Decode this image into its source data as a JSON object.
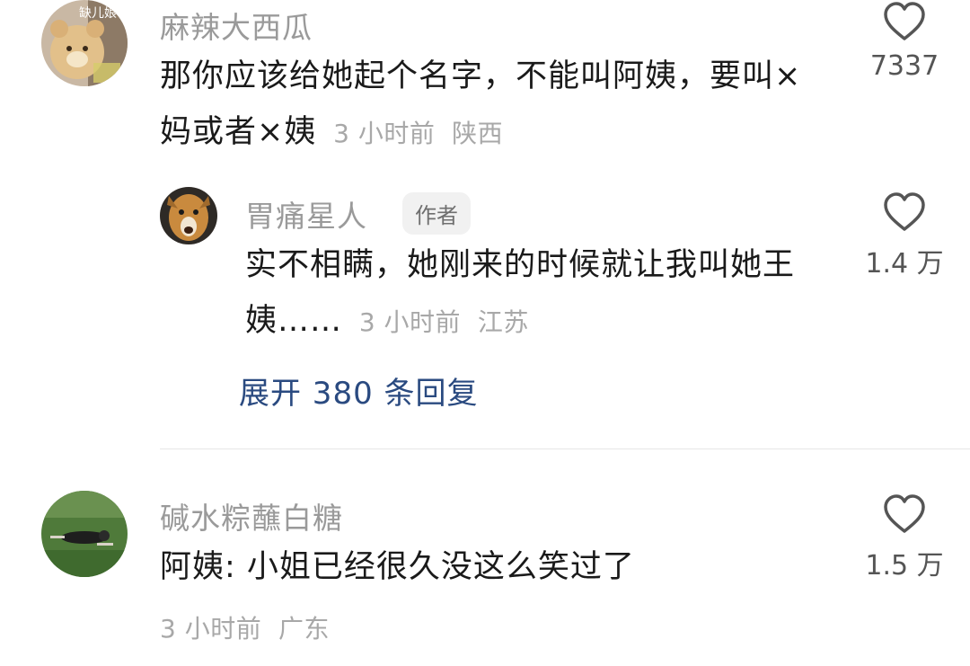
{
  "comments": [
    {
      "username": "麻辣大西瓜",
      "avatar_overlay_text": "缺儿娘",
      "text": "那你应该给她起个名字，不能叫阿姨，要叫×妈或者×姨",
      "time": "3 小时前",
      "location": "陕西",
      "likes": "7337",
      "icon": "heart-outline-icon",
      "reply": {
        "username": "胃痛星人",
        "badge": "作者",
        "text": "实不相瞒，她刚来的时候就让我叫她王姨……",
        "time": "3 小时前",
        "location": "江苏",
        "likes": "1.4 万",
        "icon": "heart-outline-icon"
      },
      "expand_replies": "展开 380 条回复"
    },
    {
      "username": "碱水粽蘸白糖",
      "text": "阿姨: 小姐已经很久没这么笑过了",
      "time": "3 小时前",
      "location": "广东",
      "likes": "1.5 万",
      "icon": "heart-outline-icon"
    }
  ],
  "colors": {
    "username": "#9a9a9a",
    "text": "#1a1a1a",
    "meta": "#a8a8a8",
    "link": "#2a4a80",
    "divider": "#e6e6e6"
  }
}
